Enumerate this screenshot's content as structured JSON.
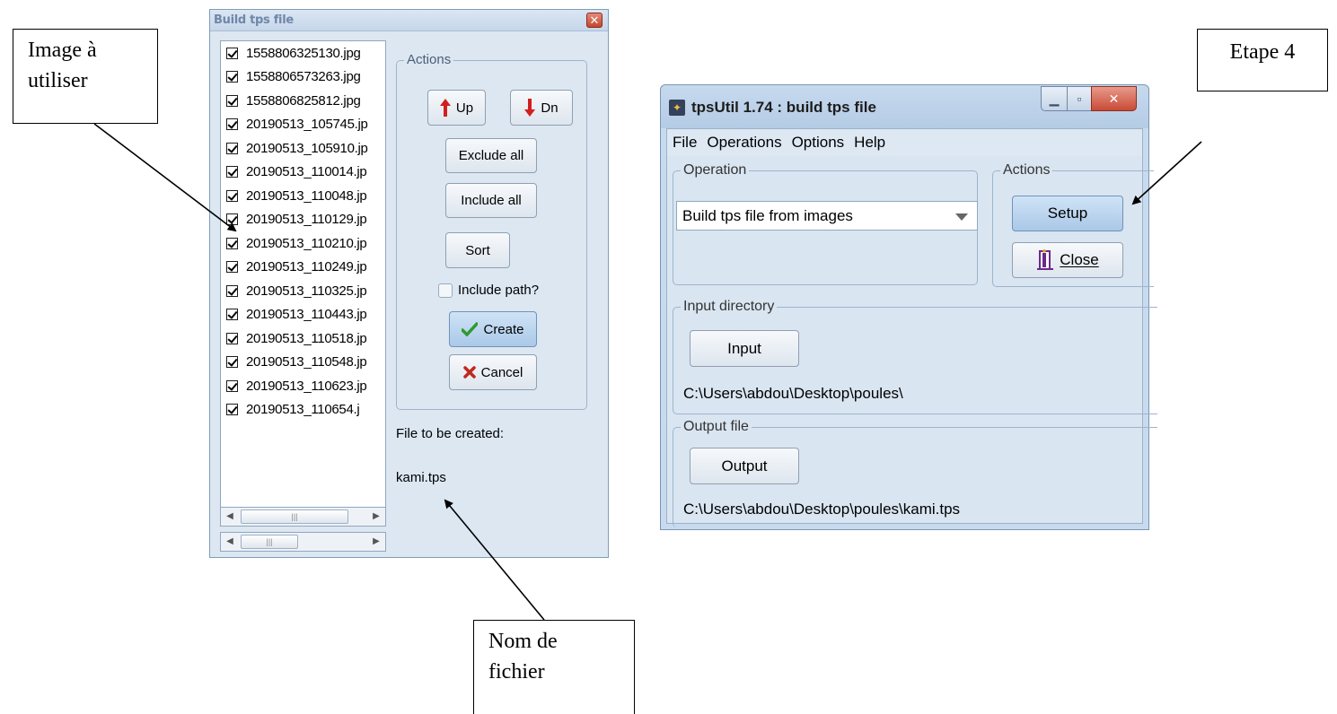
{
  "callouts": {
    "image": "Image à\nutiliser",
    "nom": "Nom de\nfichier",
    "etape": "Etape 4"
  },
  "build_dialog": {
    "title": "Build tps file",
    "close_glyph": "✕",
    "files": [
      "1558806325130.jpg",
      "1558806573263.jpg",
      "1558806825812.jpg",
      "20190513_105745.jp",
      "20190513_105910.jp",
      "20190513_110014.jp",
      "20190513_110048.jp",
      "20190513_110129.jp",
      "20190513_110210.jp",
      "20190513_110249.jp",
      "20190513_110325.jp",
      "20190513_110443.jp",
      "20190513_110518.jp",
      "20190513_110548.jp",
      "20190513_110623.jp",
      "20190513_110654.j"
    ],
    "actions_legend": "Actions",
    "up_label": "Up",
    "dn_label": "Dn",
    "exclude_all": "Exclude all",
    "include_all": "Include all",
    "sort": "Sort",
    "include_path": "Include path?",
    "create": "Create",
    "cancel": "Cancel",
    "file_to_be_created_label": "File to be created:",
    "file_name": "kami.tps",
    "scroll_thumb_grip": "|||"
  },
  "tpsutil_dialog": {
    "title": "tpsUtil 1.74 : build tps file",
    "menu": [
      "File",
      "Operations",
      "Options",
      "Help"
    ],
    "operation_legend": "Operation",
    "operation_value": "Build tps file from images",
    "actions_legend": "Actions",
    "setup": "Setup",
    "close": "Close",
    "input_legend": "Input directory",
    "input_button": "Input",
    "input_path": "C:\\Users\\abdou\\Desktop\\poules\\",
    "output_legend": "Output file",
    "output_button": "Output",
    "output_path": "C:\\Users\\abdou\\Desktop\\poules\\kami.tps"
  },
  "colors": {
    "dialog_bg": "#dce7f2",
    "create_button": "#aac8e8",
    "checkmark_green": "#2e9a2e",
    "cancel_red": "#c0281a"
  }
}
